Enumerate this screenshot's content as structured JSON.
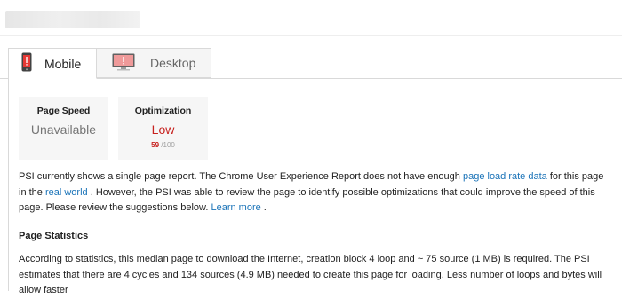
{
  "tabs": {
    "mobile_label": "Mobile",
    "desktop_label": "Desktop"
  },
  "scores": {
    "page_speed": {
      "title": "Page Speed",
      "value": "Unavailable"
    },
    "optimization": {
      "title": "Optimization",
      "value": "Low",
      "score": "59",
      "score_max": "/100"
    }
  },
  "intro": {
    "t1": "PSI currently shows a single page report. The Chrome User Experience Report does not have enough ",
    "link1": "page load rate data",
    "t2": " for this page in the ",
    "link2": "real world",
    "t3": " . However, the PSI was able to review the page to identify possible optimizations that could improve the speed of this page. Please review the suggestions below. ",
    "link3": "Learn more",
    "t4": " ."
  },
  "stats": {
    "heading": "Page Statistics",
    "text": "According to statistics, this median page to download the Internet, creation block 4 loop and ~ 75 source (1 MB) is required. The PSI estimates that there are 4 cycles and 134 sources (4.9 MB) needed to create this page for loading. Less number of loops and bytes will allow faster"
  },
  "colors": {
    "link": "#1a73b8",
    "low": "#c7221f",
    "tab_border": "#d9d9d9"
  }
}
